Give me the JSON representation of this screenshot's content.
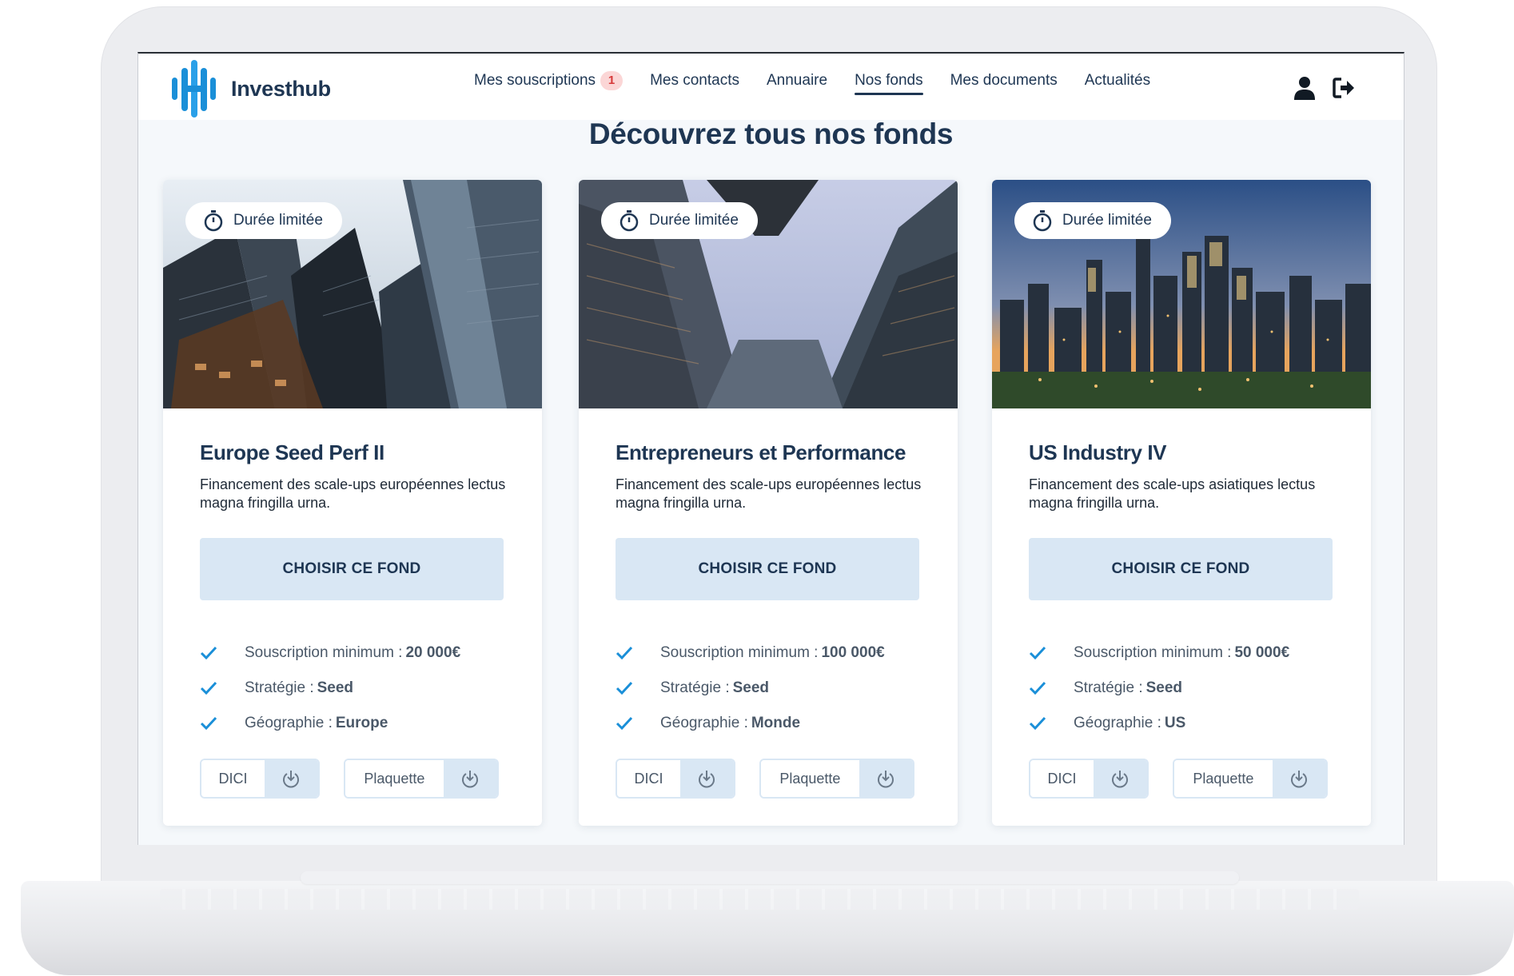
{
  "app": {
    "name": "Investhub",
    "brand_color": "#1e3653",
    "accent_color": "#1a8fd8"
  },
  "nav": {
    "items": [
      {
        "label": "Mes souscriptions",
        "badge": "1",
        "active": false
      },
      {
        "label": "Mes contacts",
        "active": false
      },
      {
        "label": "Annuaire",
        "active": false
      },
      {
        "label": "Nos fonds",
        "active": true
      },
      {
        "label": "Mes documents",
        "active": false
      },
      {
        "label": "Actualités",
        "active": false
      }
    ],
    "icons": [
      "user-icon",
      "logout-icon"
    ]
  },
  "page": {
    "title": "Découvrez tous nos fonds"
  },
  "cards": [
    {
      "tag": "Durée limitée",
      "title": "Europe Seed Perf II",
      "description": "Financement des scale-ups européennes lectus magna fringilla urna.",
      "button": "CHOISIR CE FOND",
      "features": [
        {
          "label": "Souscription minimum :",
          "value": "20 000€"
        },
        {
          "label": "Stratégie :",
          "value": "Seed"
        },
        {
          "label": "Géographie :",
          "value": "Europe"
        }
      ],
      "docs": [
        {
          "label": "DICI"
        },
        {
          "label": "Plaquette"
        }
      ]
    },
    {
      "tag": "Durée limitée",
      "title": "Entrepreneurs et Performance",
      "description": "Financement des scale-ups européennes lectus magna fringilla urna.",
      "button": "CHOISIR CE FOND",
      "features": [
        {
          "label": "Souscription minimum :",
          "value": "100 000€"
        },
        {
          "label": "Stratégie :",
          "value": "Seed"
        },
        {
          "label": "Géographie :",
          "value": "Monde"
        }
      ],
      "docs": [
        {
          "label": "DICI"
        },
        {
          "label": "Plaquette"
        }
      ]
    },
    {
      "tag": "Durée limitée",
      "title": "US Industry IV",
      "description": "Financement des scale-ups asiatiques lectus magna fringilla urna.",
      "button": "CHOISIR CE FOND",
      "features": [
        {
          "label": "Souscription minimum :",
          "value": "50 000€"
        },
        {
          "label": "Stratégie :",
          "value": "Seed"
        },
        {
          "label": "Géographie :",
          "value": "US"
        }
      ],
      "docs": [
        {
          "label": "DICI"
        },
        {
          "label": "Plaquette"
        }
      ]
    }
  ]
}
